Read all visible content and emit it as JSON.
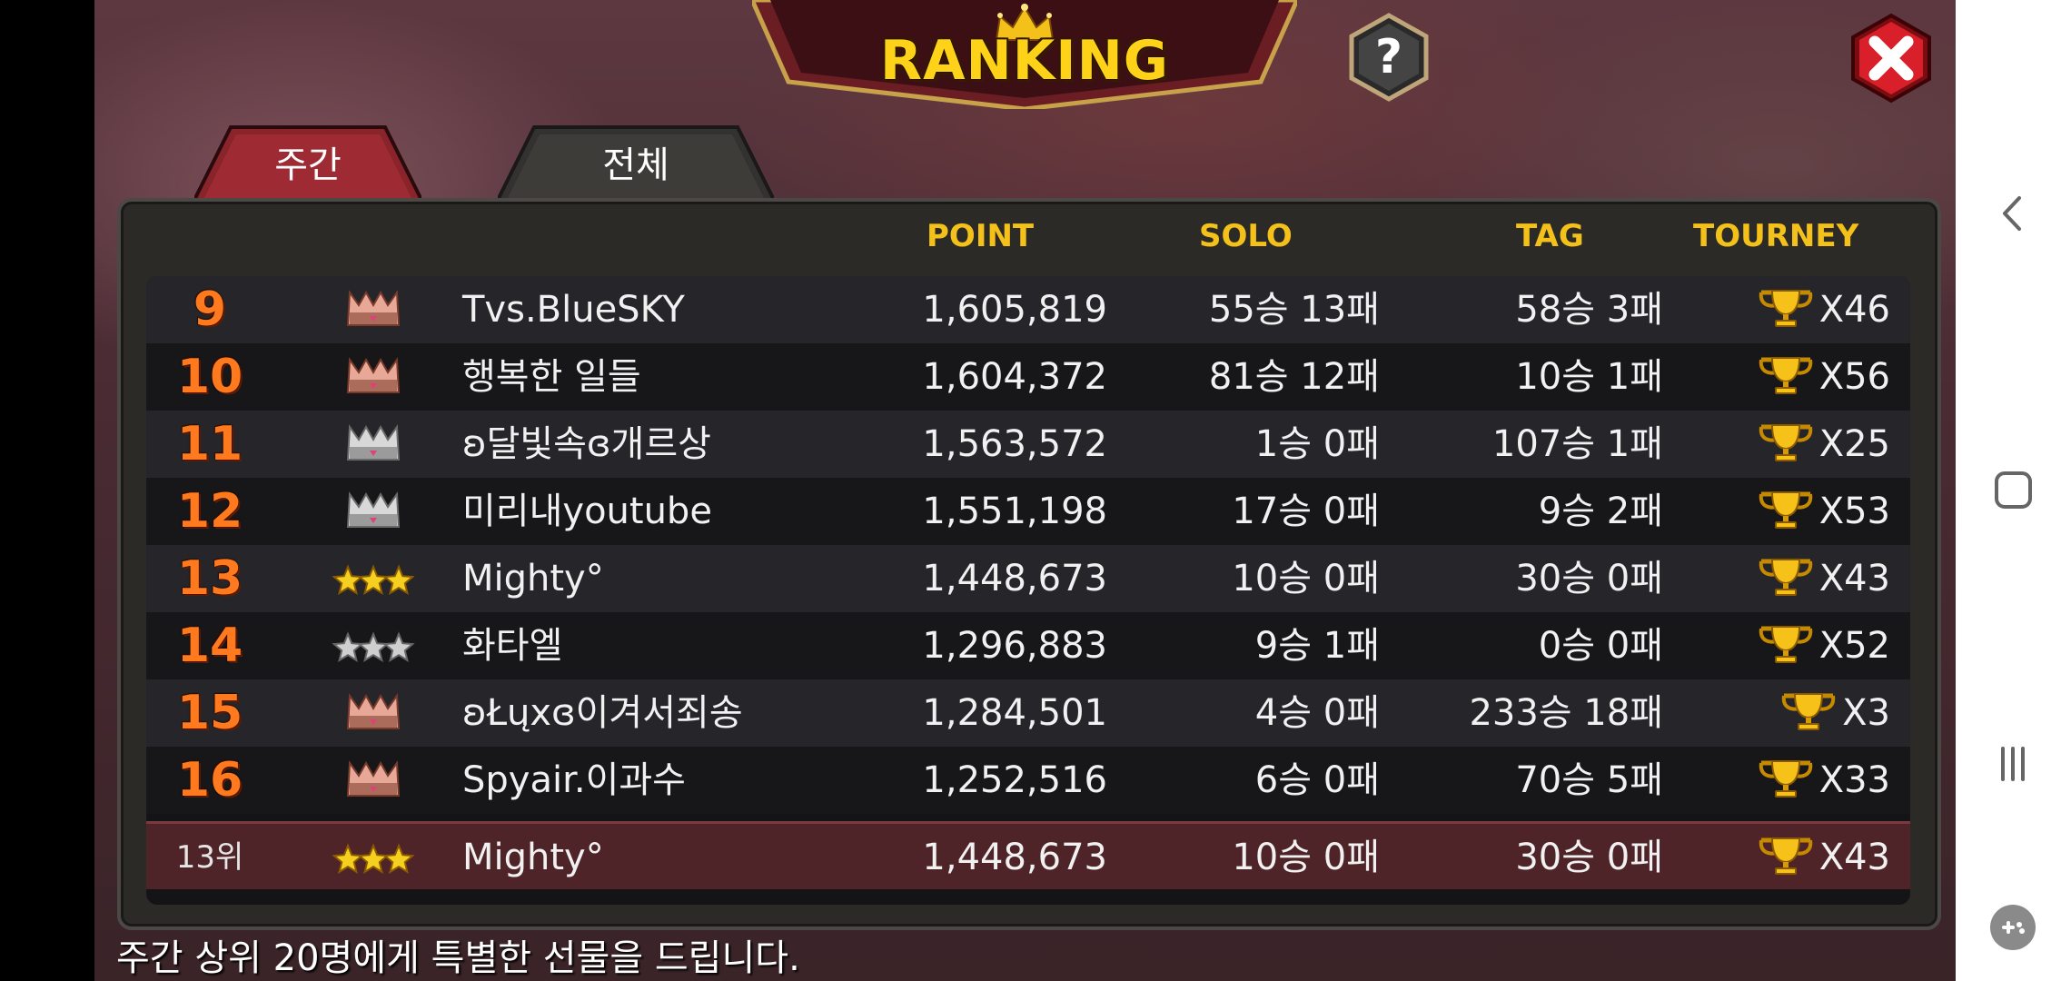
{
  "header": {
    "title": "RANKING",
    "help_icon": "question-icon",
    "close_icon": "close-icon"
  },
  "tabs": [
    {
      "label": "주간",
      "active": true
    },
    {
      "label": "전체",
      "active": false
    }
  ],
  "columns": {
    "point": "POINT",
    "solo": "SOLO",
    "tag": "TAG",
    "tourney": "TOURNEY"
  },
  "rows": [
    {
      "rank": "9",
      "badge": "crown-bronze",
      "name": "Tvs.BlueSKY",
      "point": "1,605,819",
      "solo": "55승 13패",
      "tag": "58승 3패",
      "tourney": "X46"
    },
    {
      "rank": "10",
      "badge": "crown-bronze",
      "name": "행복한 일들",
      "point": "1,604,372",
      "solo": "81승 12패",
      "tag": "10승 1패",
      "tourney": "X56"
    },
    {
      "rank": "11",
      "badge": "crown-silver",
      "name": "ʚ달빛속ɞ개르상",
      "point": "1,563,572",
      "solo": "1승 0패",
      "tag": "107승 1패",
      "tourney": "X25"
    },
    {
      "rank": "12",
      "badge": "crown-silver",
      "name": "미리내youtube",
      "point": "1,551,198",
      "solo": "17승 0패",
      "tag": "9승 2패",
      "tourney": "X53"
    },
    {
      "rank": "13",
      "badge": "stars-gold",
      "name": "Mighty°",
      "point": "1,448,673",
      "solo": "10승 0패",
      "tag": "30승 0패",
      "tourney": "X43"
    },
    {
      "rank": "14",
      "badge": "stars-silver",
      "name": "화타엘",
      "point": "1,296,883",
      "solo": "9승 1패",
      "tag": "0승 0패",
      "tourney": "X52"
    },
    {
      "rank": "15",
      "badge": "crown-bronze",
      "name": "ʚŁųxɞ이겨서죄송",
      "point": "1,284,501",
      "solo": "4승 0패",
      "tag": "233승 18패",
      "tourney": "X3"
    },
    {
      "rank": "16",
      "badge": "crown-bronze",
      "name": "Spyair.이과수",
      "point": "1,252,516",
      "solo": "6승 0패",
      "tag": "70승 5패",
      "tourney": "X33"
    }
  ],
  "my_row": {
    "rank": "13위",
    "badge": "stars-gold",
    "name": "Mighty°",
    "point": "1,448,673",
    "solo": "10승 0패",
    "tag": "30승 0패",
    "tourney": "X43"
  },
  "footer_text": "주간 상위 20명에게 특별한 선물을 드립니다.",
  "system_nav": {
    "back_icon": "back-icon",
    "home_icon": "home-icon",
    "recents_icon": "recents-icon",
    "game_tools_icon": "gamepad-icon"
  },
  "colors": {
    "accent_gold": "#f4c01a",
    "rank_orange": "#ff7a1e",
    "highlight_row": "#4f2428",
    "close_red": "#d81f2a"
  }
}
